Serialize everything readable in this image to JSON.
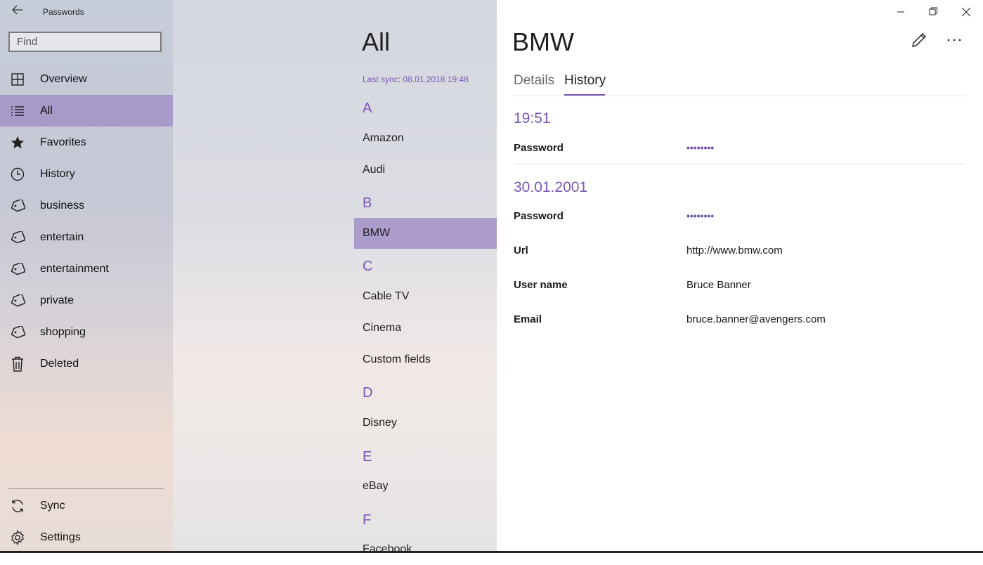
{
  "app": {
    "title": "Passwords"
  },
  "search": {
    "placeholder": "Find"
  },
  "sidebar": {
    "items": [
      {
        "label": "Overview",
        "icon": "grid-icon"
      },
      {
        "label": "All",
        "icon": "list-icon"
      },
      {
        "label": "Favorites",
        "icon": "star-icon"
      },
      {
        "label": "History",
        "icon": "clock-icon"
      },
      {
        "label": "business",
        "icon": "tag-icon"
      },
      {
        "label": "entertain",
        "icon": "tag-icon"
      },
      {
        "label": "entertainment",
        "icon": "tag-icon"
      },
      {
        "label": "private",
        "icon": "tag-icon"
      },
      {
        "label": "shopping",
        "icon": "tag-icon"
      },
      {
        "label": "Deleted",
        "icon": "trash-icon"
      }
    ],
    "bottom": [
      {
        "label": "Sync",
        "icon": "sync-icon"
      },
      {
        "label": "Settings",
        "icon": "gear-icon"
      }
    ],
    "selected": "All"
  },
  "list": {
    "title": "All",
    "last_sync": "Last sync: 08.01.2018 19:48",
    "groups": [
      {
        "letter": "A",
        "entries": [
          "Amazon",
          "Audi"
        ]
      },
      {
        "letter": "B",
        "entries": [
          "BMW"
        ]
      },
      {
        "letter": "C",
        "entries": [
          "Cable TV",
          "Cinema",
          "Custom fields"
        ]
      },
      {
        "letter": "D",
        "entries": [
          "Disney"
        ]
      },
      {
        "letter": "E",
        "entries": [
          "eBay"
        ]
      },
      {
        "letter": "F",
        "entries": [
          "Facebook"
        ]
      }
    ],
    "selected": "BMW"
  },
  "detail": {
    "title": "BMW",
    "tabs": [
      "Details",
      "History"
    ],
    "active_tab": "History",
    "history": [
      {
        "time": "19:51",
        "fields": [
          {
            "label": "Password",
            "value": "••••••••"
          }
        ]
      },
      {
        "time": "30.01.2001",
        "fields": [
          {
            "label": "Password",
            "value": "••••••••"
          },
          {
            "label": "Url",
            "value": "http://www.bmw.com"
          },
          {
            "label": "User name",
            "value": "Bruce Banner"
          },
          {
            "label": "Email",
            "value": "bruce.banner@avengers.com"
          }
        ]
      }
    ]
  },
  "colors": {
    "accent": "#7b57b6",
    "nav_selected": "#a79ac9",
    "list_selected": "#ab9ccb"
  }
}
